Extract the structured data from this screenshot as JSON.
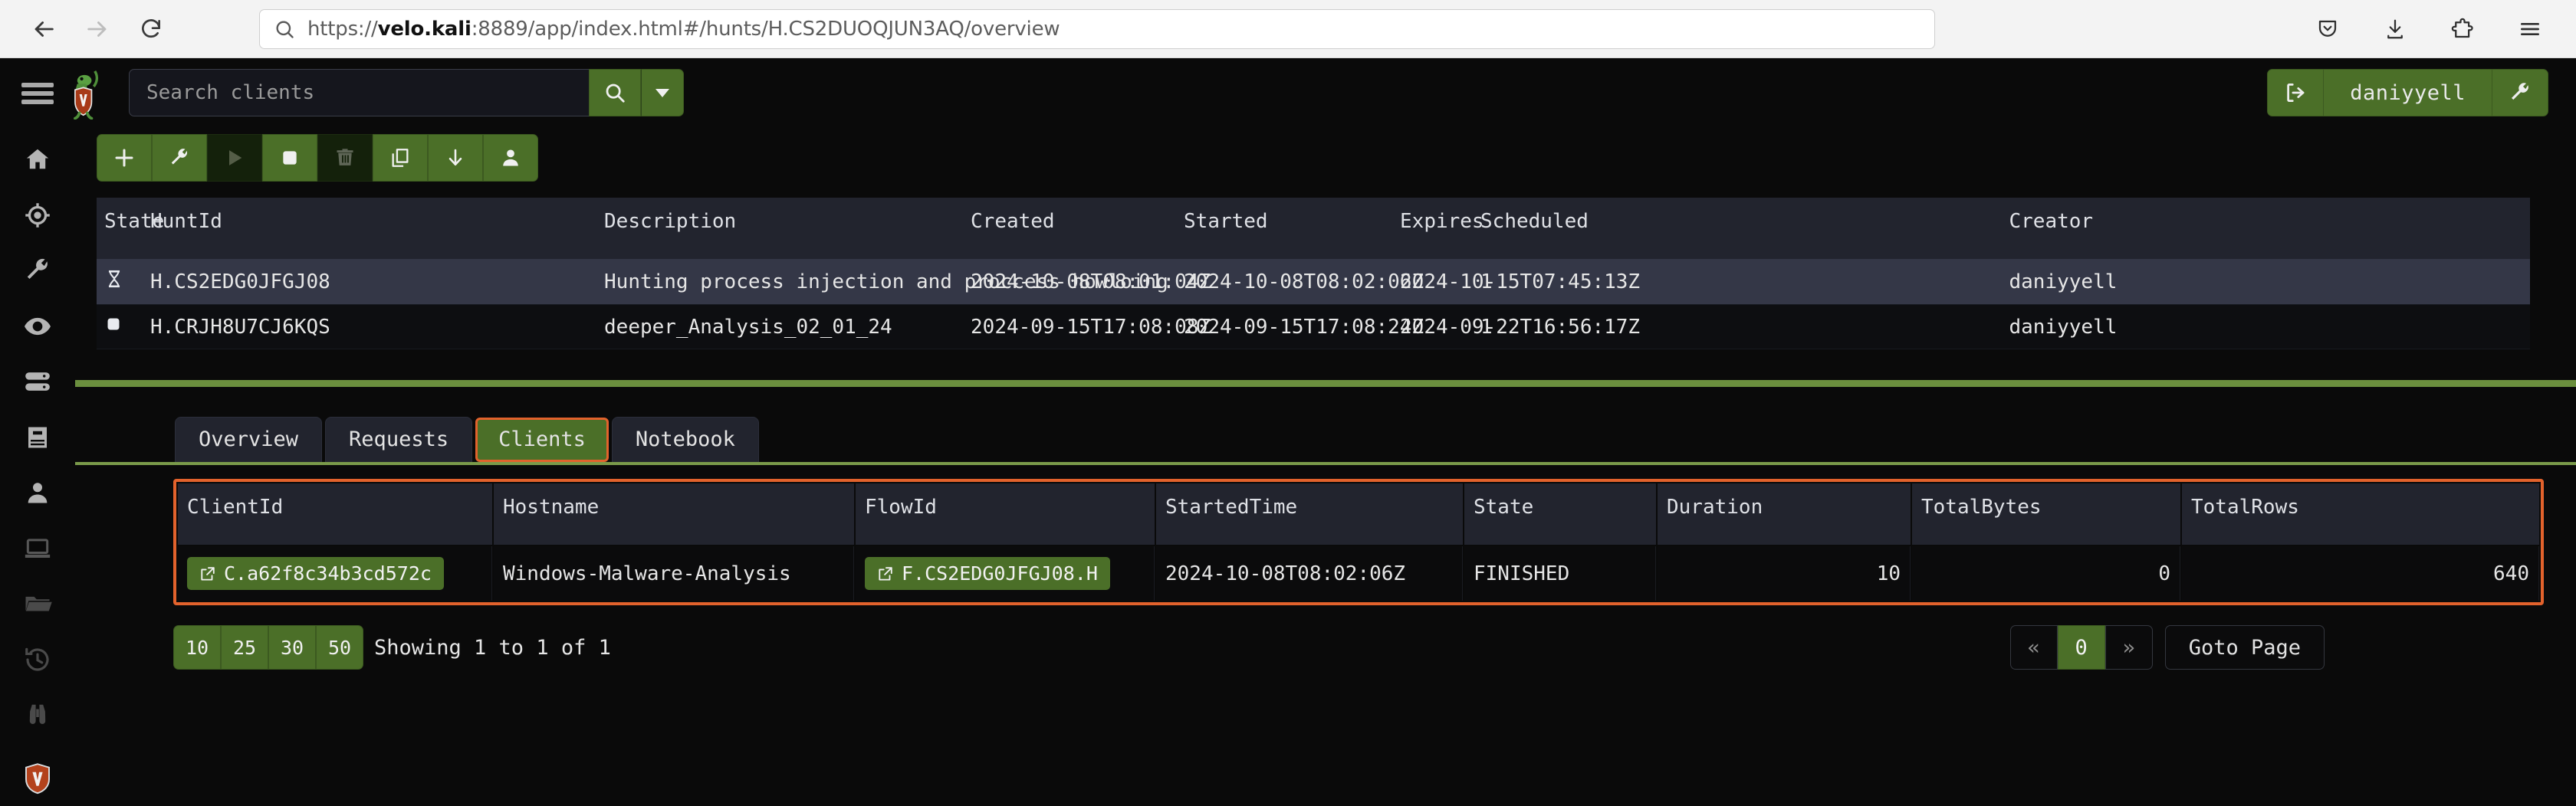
{
  "browser": {
    "back_icon": "back-arrow-icon",
    "forward_icon": "forward-arrow-icon",
    "reload_icon": "reload-icon",
    "url_prefix": "https://",
    "url_host": "velo.kali",
    "url_rest": ":8889/app/index.html#/hunts/H.CS2DUOQJUN3AQ/overview",
    "url_full": "https://velo.kali:8889/app/index.html#/hunts/H.CS2DUOQJUN3AQ/overview",
    "right_icons": [
      "pocket-save-icon",
      "downloads-icon",
      "extensions-icon",
      "app-menu-icon"
    ]
  },
  "sidebar": {
    "items": [
      {
        "name": "home",
        "icon": "home-icon"
      },
      {
        "name": "hunts",
        "icon": "crosshair-icon"
      },
      {
        "name": "artifacts",
        "icon": "wrench-icon"
      },
      {
        "name": "view",
        "icon": "eye-icon"
      },
      {
        "name": "server",
        "icon": "server-icon"
      },
      {
        "name": "notebooks",
        "icon": "book-icon"
      },
      {
        "name": "users",
        "icon": "user-icon"
      },
      {
        "name": "clients",
        "icon": "laptop-icon"
      },
      {
        "name": "files",
        "icon": "folder-icon"
      },
      {
        "name": "history",
        "icon": "history-icon"
      },
      {
        "name": "search",
        "icon": "binoculars-icon"
      },
      {
        "name": "velociraptor-logo",
        "icon": "shield-v-icon"
      }
    ]
  },
  "header": {
    "menu_icon": "hamburger-menu-icon",
    "logo_icon": "velociraptor-logo-icon",
    "search": {
      "placeholder": "Search clients",
      "value": "",
      "go_icon": "search-icon",
      "caret_icon": "chevron-down-icon"
    },
    "user": {
      "logout_icon": "logout-icon",
      "name": "daniyyell",
      "settings_icon": "wrench-icon"
    }
  },
  "toolbar": {
    "buttons": [
      {
        "name": "new-hunt-button",
        "icon": "plus-icon",
        "enabled": true
      },
      {
        "name": "modify-hunt-button",
        "icon": "wrench-icon",
        "enabled": true
      },
      {
        "name": "run-hunt-button",
        "icon": "play-icon",
        "enabled": false
      },
      {
        "name": "stop-hunt-button",
        "icon": "stop-icon",
        "enabled": true
      },
      {
        "name": "delete-hunt-button",
        "icon": "trash-icon",
        "enabled": false
      },
      {
        "name": "copy-hunt-button",
        "icon": "copy-icon",
        "enabled": true
      },
      {
        "name": "download-results-button",
        "icon": "download-icon",
        "enabled": true
      },
      {
        "name": "add-clients-button",
        "icon": "person-icon",
        "enabled": true
      }
    ]
  },
  "hunts": {
    "columns": [
      "State",
      "HuntId",
      "Description",
      "Created",
      "Started",
      "Expires",
      "Scheduled",
      "Creator"
    ],
    "rows": [
      {
        "state_icon": "hourglass-icon",
        "hunt_id": "H.CS2EDG0JFGJ08",
        "description": "Hunting process injection and proccess howloing",
        "created": "2024-10-08T08:01:04Z",
        "started": "2024-10-08T08:02:06Z",
        "expires": "2024-10-15T07:45:13Z",
        "scheduled": "1",
        "creator": "daniyyell",
        "selected": true
      },
      {
        "state_icon": "stop-icon",
        "hunt_id": "H.CRJH8U7CJ6KQS",
        "description": "deeper_Analysis_02_01_24",
        "created": "2024-09-15T17:08:08Z",
        "started": "2024-09-15T17:08:24Z",
        "expires": "2024-09-22T16:56:17Z",
        "scheduled": "1",
        "creator": "daniyyell",
        "selected": false
      }
    ]
  },
  "tabs": [
    {
      "label": "Overview",
      "active": false
    },
    {
      "label": "Requests",
      "active": false
    },
    {
      "label": "Clients",
      "active": true
    },
    {
      "label": "Notebook",
      "active": false
    }
  ],
  "clients": {
    "columns": [
      "ClientId",
      "Hostname",
      "FlowId",
      "StartedTime",
      "State",
      "Duration",
      "TotalBytes",
      "TotalRows"
    ],
    "rows": [
      {
        "client_id": "C.a62f8c34b3cd572c",
        "client_id_icon": "external-link-icon",
        "hostname": "Windows-Malware-Analysis",
        "flow_id": "F.CS2EDG0JFGJ08.H",
        "flow_id_icon": "external-link-icon",
        "started_time": "2024-10-08T08:02:06Z",
        "state": "FINISHED",
        "duration": "10",
        "total_bytes": "0",
        "total_rows": "640"
      }
    ]
  },
  "footer": {
    "page_sizes": [
      "10",
      "25",
      "30",
      "50"
    ],
    "showing": "Showing 1 to 1 of 1",
    "prev_label": "«",
    "current_page": "0",
    "next_label": "»",
    "goto_label": "Goto Page"
  },
  "colors": {
    "accent_green": "#4b6f28",
    "highlight_orange": "#e2622c",
    "divider_green": "#6b8f3e",
    "panel_dark": "#22242e",
    "row_selected": "#343747"
  }
}
